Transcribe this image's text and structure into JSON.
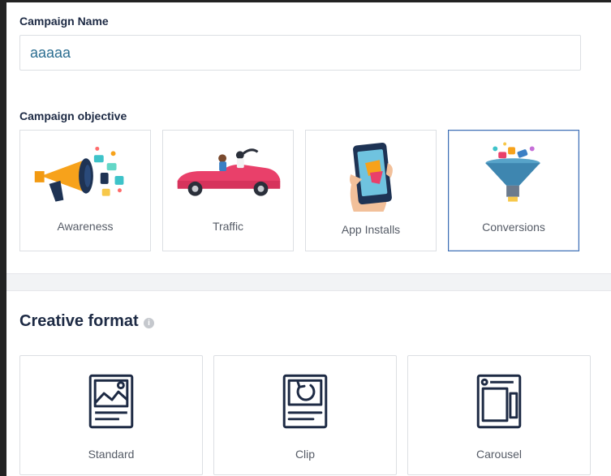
{
  "campaign_name": {
    "label": "Campaign Name",
    "value": "aaaaa"
  },
  "campaign_objective": {
    "label": "Campaign objective",
    "options": [
      {
        "label": "Awareness",
        "icon": "megaphone-icon",
        "selected": false
      },
      {
        "label": "Traffic",
        "icon": "car-icon",
        "selected": false
      },
      {
        "label": "App Installs",
        "icon": "phone-icon",
        "selected": false
      },
      {
        "label": "Conversions",
        "icon": "funnel-icon",
        "selected": true
      }
    ]
  },
  "creative_format": {
    "title": "Creative format",
    "info_icon": "info-icon",
    "options": [
      {
        "label": "Standard",
        "icon": "image-post-icon"
      },
      {
        "label": "Clip",
        "icon": "clip-replay-icon"
      },
      {
        "label": "Carousel",
        "icon": "carousel-icon"
      }
    ]
  },
  "colors": {
    "accent": "#3f6fb5",
    "heading": "#1d2a44",
    "input_text": "#2c6e91",
    "border": "#dcdfe3"
  }
}
